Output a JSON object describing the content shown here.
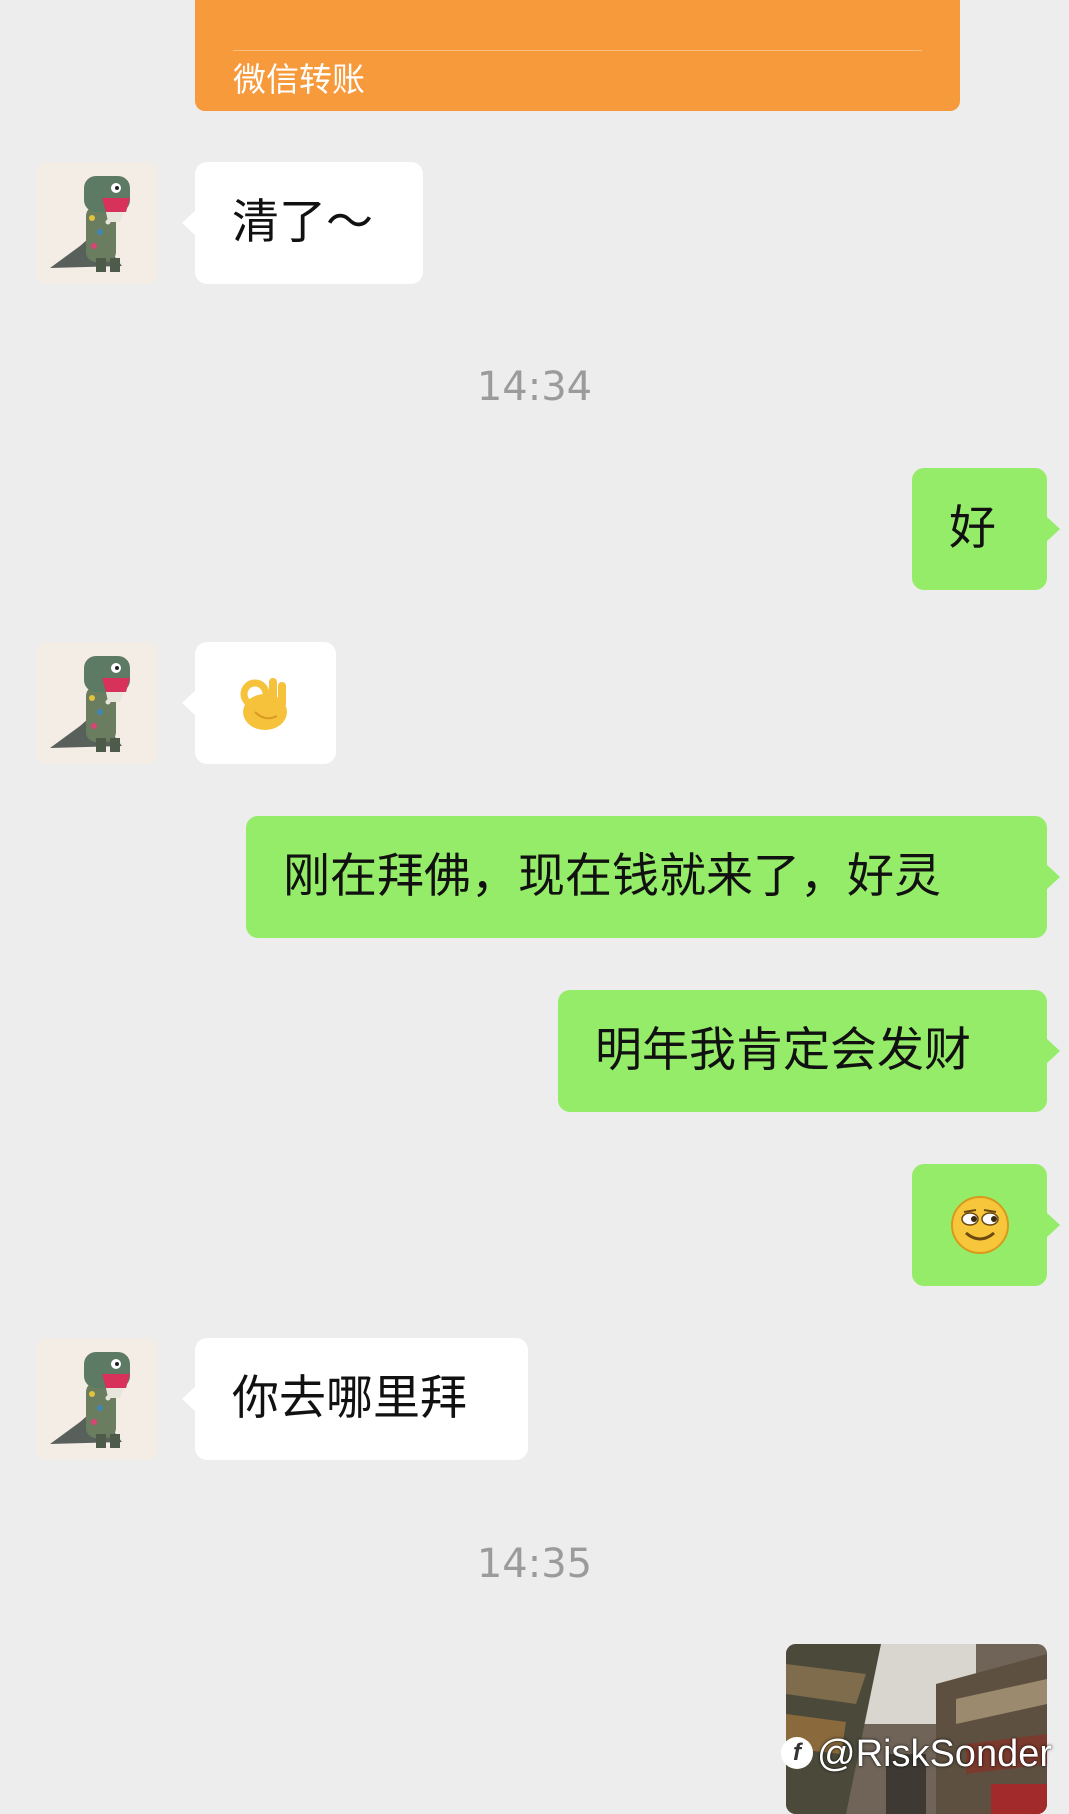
{
  "transfer": {
    "label": "微信转账"
  },
  "messages": {
    "m1": {
      "text": "清了～"
    },
    "t1": {
      "text": "14:34"
    },
    "m2": {
      "text": "好"
    },
    "m3": {
      "emoji": "👌"
    },
    "m4": {
      "text": "刚在拜佛，现在钱就来了，好灵"
    },
    "m5": {
      "text": "明年我肯定会发财"
    },
    "m6": {
      "emoji": "😏"
    },
    "m7": {
      "text": "你去哪里拜"
    },
    "t2": {
      "text": "14:35"
    }
  },
  "watermark": {
    "text": "@RiskSonder"
  },
  "colors": {
    "background": "#ededed",
    "incoming_bubble": "#ffffff",
    "outgoing_bubble": "#95ec69",
    "transfer_card": "#f79a3c",
    "timestamp": "#9b9b9b"
  },
  "icons": {
    "avatar": "dinosaur-avatar-icon",
    "watermark_logo": "app-logo-icon"
  }
}
